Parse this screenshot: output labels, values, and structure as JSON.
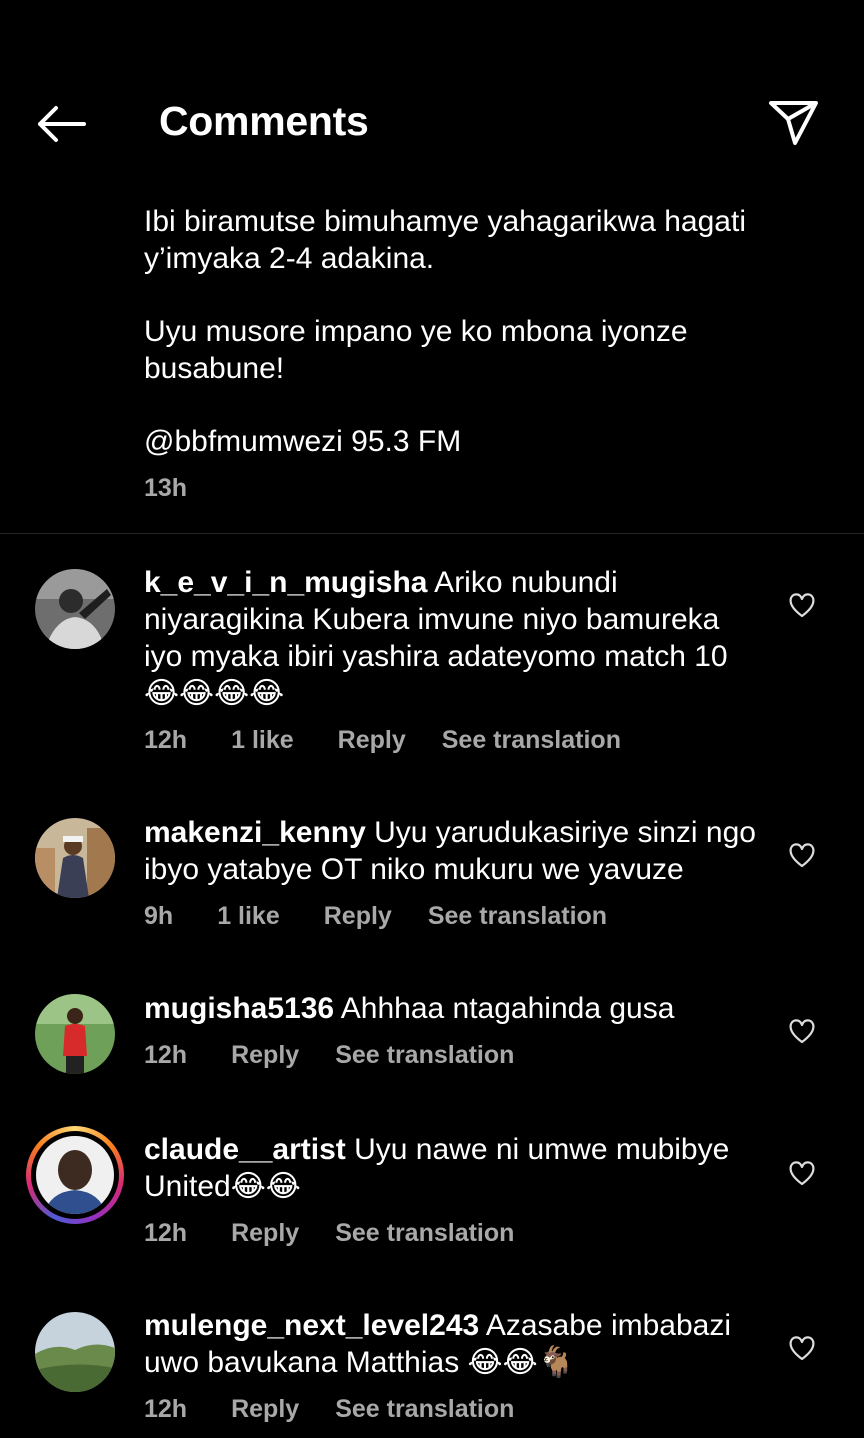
{
  "header": {
    "title": "Comments"
  },
  "caption": {
    "para1": "Ibi biramutse bimuhamye yahagarikwa hagati y’imyaka 2-4 adakina.",
    "para2": "Uyu musore impano ye ko mbona iyonze busabune!",
    "mention": "@bbfmumwezi",
    "mention_suffix": " 95.3 FM",
    "time": "13h"
  },
  "labels": {
    "reply": "Reply",
    "see_translation": "See translation"
  },
  "comments": [
    {
      "username": "k_e_v_i_n_mugisha",
      "text": " Ariko nubundi niyaragikina Kubera imvune niyo bamureka iyo myaka ibiri yashira adateyomo match 10 😂😂😂😂",
      "time": "12h",
      "likes": "1 like"
    },
    {
      "username": "makenzi_kenny",
      "text": " Uyu yarudukasiriye sinzi ngo ibyo yatabye OT niko mukuru we yavuze",
      "time": "9h",
      "likes": "1 like"
    },
    {
      "username": "mugisha5136",
      "text": " Ahhhaa ntagahinda gusa",
      "time": "12h"
    },
    {
      "username": "claude__artist",
      "text": " Uyu nawe ni umwe mubibye United😂😂",
      "time": "12h"
    },
    {
      "username": "mulenge_next_level243",
      "text": " Azasabe imbabazi uwo bavukana Matthias 😂😂🐐",
      "time": "12h"
    }
  ]
}
